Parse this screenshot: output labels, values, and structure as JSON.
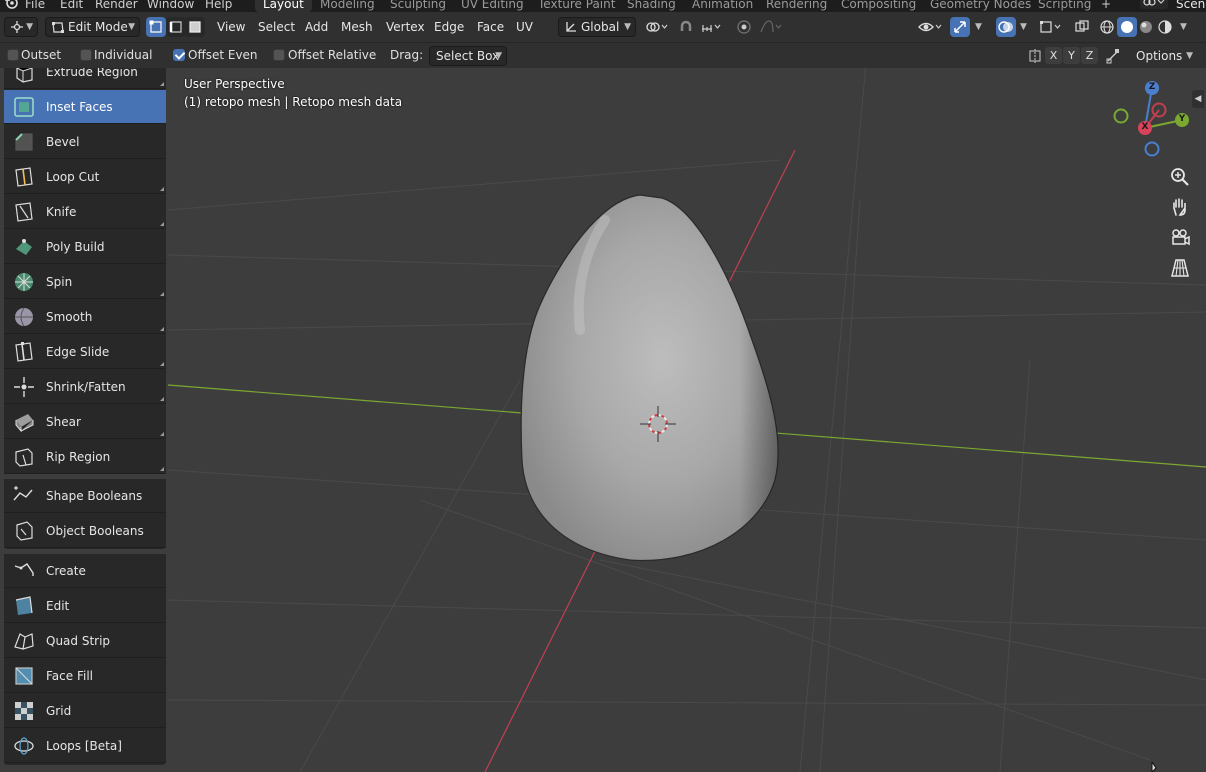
{
  "menubar": {
    "items": [
      "File",
      "Edit",
      "Render",
      "Window",
      "Help"
    ],
    "workspaces": [
      "Layout",
      "Modeling",
      "Sculpting",
      "UV Editing",
      "Texture Paint",
      "Shading",
      "Animation",
      "Rendering",
      "Compositing",
      "Geometry Nodes",
      "Scripting"
    ],
    "active_workspace": "Layout",
    "add_tab": "+",
    "scene_label": "Scene"
  },
  "header": {
    "mode": "Edit Mode",
    "menus": [
      "View",
      "Select",
      "Add",
      "Mesh",
      "Vertex",
      "Edge",
      "Face",
      "UV"
    ],
    "transform_orientation": "Global"
  },
  "tool_settings": {
    "outset": {
      "label": "Outset",
      "checked": false
    },
    "individual": {
      "label": "Individual",
      "checked": false
    },
    "offset_even": {
      "label": "Offset Even",
      "checked": true
    },
    "offset_relative": {
      "label": "Offset Relative",
      "checked": false
    },
    "drag_label": "Drag:",
    "drag_value": "Select Box",
    "axes": [
      "X",
      "Y",
      "Z"
    ],
    "options_label": "Options"
  },
  "viewport": {
    "perspective": "User Perspective",
    "object_info": "(1) retopo mesh | Retopo mesh data",
    "accent_color": "#4772b3",
    "x_axis_color": "#c04050",
    "y_axis_color": "#7aa831"
  },
  "gizmo": {
    "x": "X",
    "y": "Y",
    "z": "Z"
  },
  "tools": {
    "group1": [
      {
        "label": "Extrude Region",
        "icon": "extrude-region-icon",
        "sub": true
      },
      {
        "label": "Inset Faces",
        "icon": "inset-faces-icon",
        "sub": false,
        "active": true
      },
      {
        "label": "Bevel",
        "icon": "bevel-icon",
        "sub": false
      },
      {
        "label": "Loop Cut",
        "icon": "loop-cut-icon",
        "sub": true
      },
      {
        "label": "Knife",
        "icon": "knife-icon",
        "sub": true
      },
      {
        "label": "Poly Build",
        "icon": "poly-build-icon",
        "sub": false
      },
      {
        "label": "Spin",
        "icon": "spin-icon",
        "sub": true
      },
      {
        "label": "Smooth",
        "icon": "smooth-icon",
        "sub": true
      },
      {
        "label": "Edge Slide",
        "icon": "edge-slide-icon",
        "sub": true
      },
      {
        "label": "Shrink/Fatten",
        "icon": "shrink-fatten-icon",
        "sub": true
      },
      {
        "label": "Shear",
        "icon": "shear-icon",
        "sub": true
      },
      {
        "label": "Rip Region",
        "icon": "rip-region-icon",
        "sub": true
      }
    ],
    "group2": [
      {
        "label": "Shape Booleans",
        "icon": "shape-booleans-icon"
      },
      {
        "label": "Object Booleans",
        "icon": "object-booleans-icon"
      }
    ],
    "group3": [
      {
        "label": "Create",
        "icon": "create-icon"
      },
      {
        "label": "Edit",
        "icon": "edit-icon"
      },
      {
        "label": "Quad Strip",
        "icon": "quad-strip-icon"
      },
      {
        "label": "Face Fill",
        "icon": "face-fill-icon"
      },
      {
        "label": "Grid",
        "icon": "grid-icon"
      },
      {
        "label": "Loops [Beta]",
        "icon": "loops-icon"
      }
    ]
  }
}
